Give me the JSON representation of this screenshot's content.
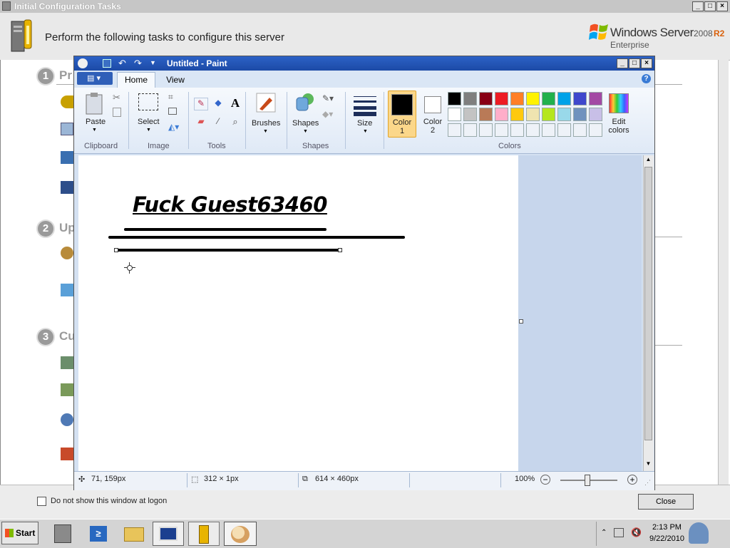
{
  "ict": {
    "title": "Initial Configuration Tasks",
    "header_message": "Perform the following tasks to configure this server",
    "logo_text": "Windows Server",
    "logo_version": "2008",
    "logo_r2": "R2",
    "logo_edition": "Enterprise",
    "steps": [
      {
        "number": "1",
        "label": "Pr"
      },
      {
        "number": "2",
        "label": "Up"
      },
      {
        "number": "3",
        "label": "Cu"
      }
    ],
    "footer": {
      "checkbox_label": "Do not show this window at logon",
      "close_label": "Close"
    }
  },
  "paint": {
    "title": "Untitled - Paint",
    "tabs": {
      "home": "Home",
      "view": "View"
    },
    "groups": {
      "clipboard": "Clipboard",
      "image": "Image",
      "tools": "Tools",
      "shapes": "Shapes",
      "colors": "Colors"
    },
    "buttons": {
      "paste": "Paste",
      "select": "Select",
      "brushes": "Brushes",
      "shapes": "Shapes",
      "size": "Size",
      "color1": "Color\n1",
      "color2": "Color\n2",
      "edit_colors": "Edit\ncolors"
    },
    "canvas_text": "Fuck Guest63460",
    "status": {
      "cursor_pos": "71, 159px",
      "selection_size": "312 × 1px",
      "image_size": "614 × 460px",
      "zoom": "100%"
    },
    "palette_row1": [
      "#000000",
      "#7f7f7f",
      "#880015",
      "#ed1c24",
      "#ff7f27",
      "#fff200",
      "#22b14c",
      "#00a2e8",
      "#3f48cc",
      "#a349a4"
    ],
    "palette_row2": [
      "#ffffff",
      "#c3c3c3",
      "#b97a57",
      "#ffaec9",
      "#ffc90e",
      "#efe4b0",
      "#b5e61d",
      "#99d9ea",
      "#7092be",
      "#c8bfe7"
    ]
  },
  "taskbar": {
    "start": "Start",
    "time": "2:13 PM",
    "date": "9/22/2010"
  }
}
